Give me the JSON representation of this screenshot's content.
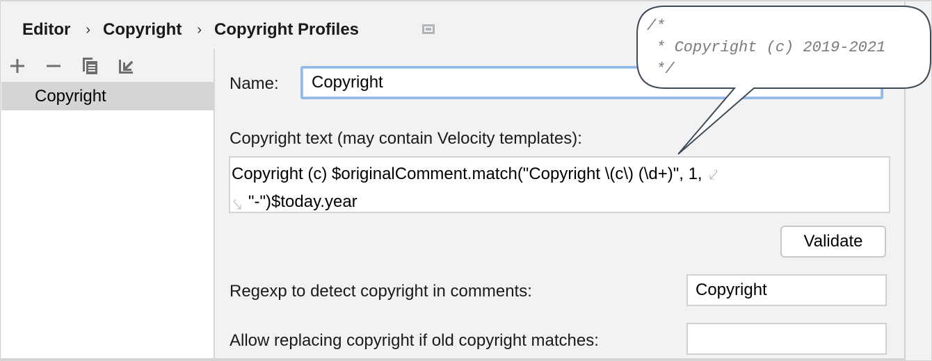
{
  "breadcrumb": {
    "items": [
      "Editor",
      "Copyright",
      "Copyright Profiles"
    ],
    "separator": "›",
    "trailing_icon": "window-layout-icon"
  },
  "left_panel": {
    "toolbar": [
      {
        "name": "add",
        "icon": "plus-icon",
        "glyph": "+"
      },
      {
        "name": "remove",
        "icon": "minus-icon",
        "glyph": "−"
      },
      {
        "name": "copy",
        "icon": "copy-icon"
      },
      {
        "name": "import",
        "icon": "import-icon"
      }
    ],
    "profiles": [
      {
        "label": "Copyright",
        "selected": true
      }
    ]
  },
  "form": {
    "name_label": "Name:",
    "name_value": "Copyright",
    "copyright_text_label": "Copyright text (may contain Velocity templates):",
    "copyright_text_line1": "Copyright (c) $originalComment.match(\"Copyright \\(c\\) (\\d+)\", 1,",
    "copyright_text_line2": "\"-\")$today.year",
    "soft_wrap_glyph_end": "⤦",
    "soft_wrap_glyph_start": "⤥",
    "validate_label": "Validate",
    "regexp_label": "Regexp to detect copyright in comments:",
    "regexp_value": "Copyright",
    "allow_replacing_label": "Allow replacing copyright if old copyright matches:",
    "allow_replacing_value": ""
  },
  "callout": {
    "lines": [
      "/*",
      " * Copyright (c) 2019-2021",
      " */"
    ]
  },
  "colors": {
    "background": "#f2f2f2",
    "selected_item": "#d5d5d5",
    "focus_border": "#93b9e6",
    "callout_stroke": "#3d4a55",
    "comment_text": "#7a7a7a"
  }
}
